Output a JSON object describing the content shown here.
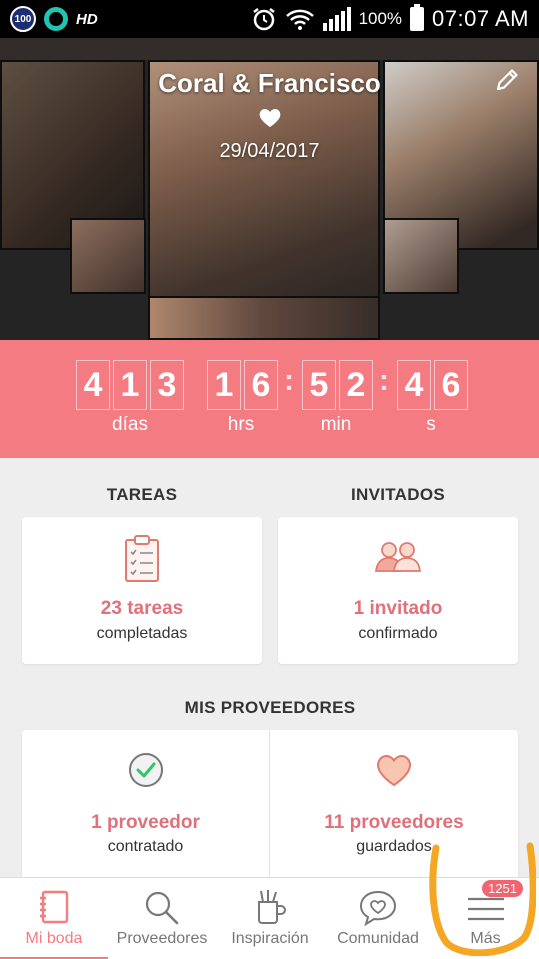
{
  "status_bar": {
    "badge_number": "100",
    "hd_label": "HD",
    "battery": "100%",
    "time": "07:07 AM"
  },
  "hero": {
    "couple_name": "Coral & Francisco",
    "wedding_date": "29/04/2017"
  },
  "countdown": {
    "days_digits": [
      "4",
      "1",
      "3"
    ],
    "hours_digits": [
      "1",
      "6"
    ],
    "minutes_digits": [
      "5",
      "2"
    ],
    "seconds_digits": [
      "4",
      "6"
    ],
    "labels": {
      "days": "días",
      "hours": "hrs",
      "minutes": "min",
      "seconds": "s"
    }
  },
  "tareas": {
    "title": "TAREAS",
    "count_text": "23 tareas",
    "sub_text": "completadas"
  },
  "invitados": {
    "title": "INVITADOS",
    "count_text": "1 invitado",
    "sub_text": "confirmado"
  },
  "proveedores": {
    "title": "MIS PROVEEDORES",
    "contracted_text": "1 proveedor",
    "contracted_sub": "contratado",
    "saved_text": "11 proveedores",
    "saved_sub": "guardados"
  },
  "bottom_nav": {
    "items": [
      {
        "label": "Mi boda",
        "icon": "notebook-icon",
        "active": true
      },
      {
        "label": "Proveedores",
        "icon": "search-icon",
        "active": false
      },
      {
        "label": "Inspiración",
        "icon": "cup-icon",
        "active": false
      },
      {
        "label": "Comunidad",
        "icon": "chat-heart-icon",
        "active": false
      },
      {
        "label": "Más",
        "icon": "menu-icon",
        "active": false,
        "badge": "1251"
      }
    ]
  },
  "colors": {
    "accent": "#f47b82",
    "accent_text": "#e0707a",
    "annotation": "#f5a623"
  }
}
